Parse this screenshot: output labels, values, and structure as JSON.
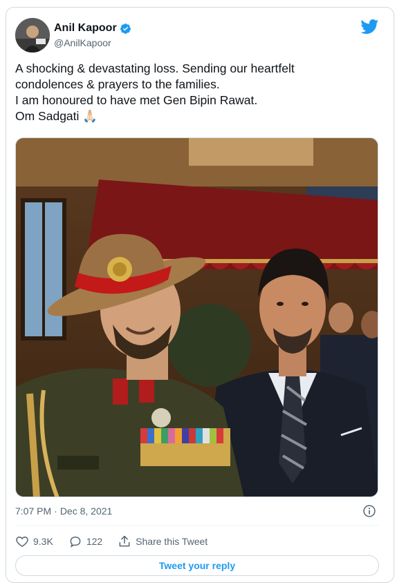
{
  "tweet": {
    "author_name": "Anil Kapoor",
    "handle": "@AnilKapoor",
    "text_lines": [
      "A shocking & devastating loss. Sending our heartfelt",
      "condolences & prayers to the families.",
      "I am honoured to have met Gen Bipin Rawat.",
      "Om Sadgati 🙏🏻"
    ],
    "time": "7:07 PM",
    "separator": "·",
    "date": "Dec 8, 2021"
  },
  "actions": {
    "likes": "9.3K",
    "replies": "122",
    "share_label": "Share this Tweet",
    "reply_button_label": "Tweet your reply"
  },
  "colors": {
    "brand": "#1d9bf0",
    "text": "#0f1419",
    "muted": "#536471"
  },
  "icons": {
    "logo": "twitter-bird-icon",
    "verified": "verified-badge-icon",
    "like": "heart-icon",
    "reply": "reply-bubble-icon",
    "share": "share-icon",
    "info": "info-icon"
  }
}
